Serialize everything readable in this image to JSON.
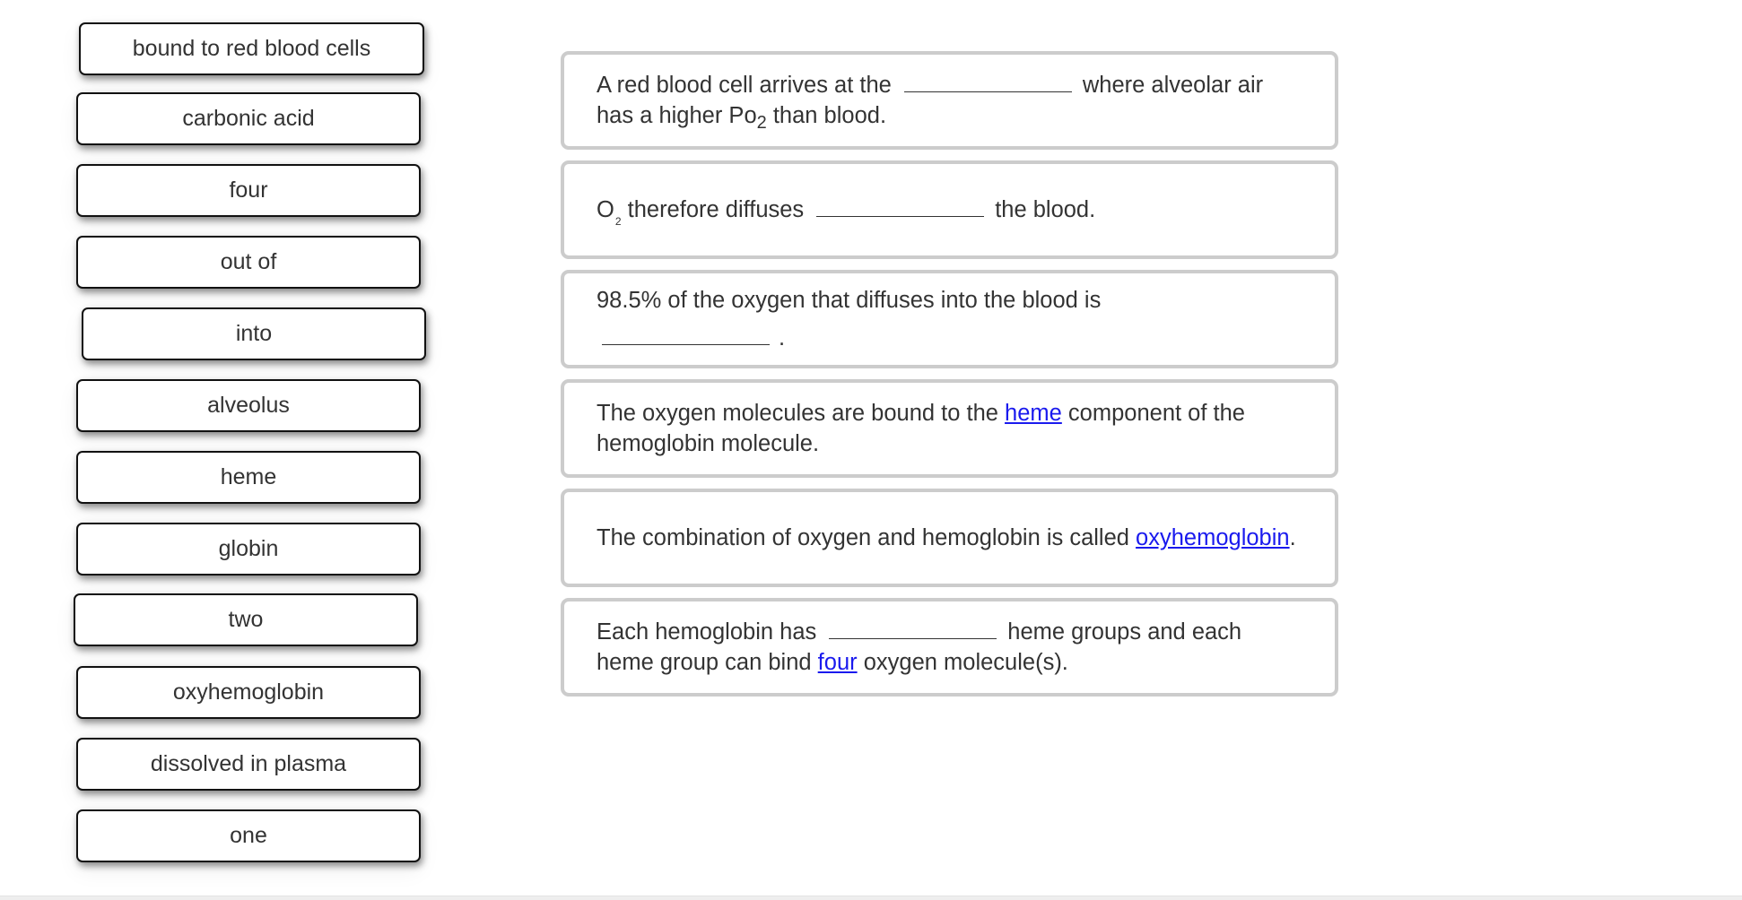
{
  "word_bank": {
    "tiles": [
      {
        "label": "bound to red blood cells"
      },
      {
        "label": "carbonic acid"
      },
      {
        "label": "four"
      },
      {
        "label": "out of"
      },
      {
        "label": "into"
      },
      {
        "label": "alveolus"
      },
      {
        "label": "heme"
      },
      {
        "label": "globin"
      },
      {
        "label": "two"
      },
      {
        "label": "oxyhemoglobin"
      },
      {
        "label": "dissolved in plasma"
      },
      {
        "label": "one"
      }
    ]
  },
  "statements": [
    {
      "part1": "A red blood cell arrives at the",
      "blank": "",
      "part2": "where alveolar air has a higher Po",
      "subscript": "2",
      "part3": " than blood."
    },
    {
      "part0": "O",
      "subscript": "2",
      "part1": " therefore diffuses",
      "blank": "",
      "part2": "the blood."
    },
    {
      "part1": "98.5% of the oxygen that diffuses into the blood is",
      "blank": "",
      "part2": "."
    },
    {
      "part1": "The oxygen molecules are bound to the ",
      "filled": "heme",
      "part2": " component of the hemoglobin molecule."
    },
    {
      "part1": "The combination of oxygen and hemoglobin is called ",
      "filled": "oxyhemoglobin",
      "part2": "."
    },
    {
      "part1": "Each hemoglobin has",
      "blank": "",
      "part2": "heme groups and each heme group can bind ",
      "filled": "four",
      "part3": " oxygen molecule(s)."
    }
  ],
  "colors": {
    "text": "#333333",
    "link": "#1a1aee",
    "panel_border": "#cccccc",
    "tile_border": "#111111"
  }
}
